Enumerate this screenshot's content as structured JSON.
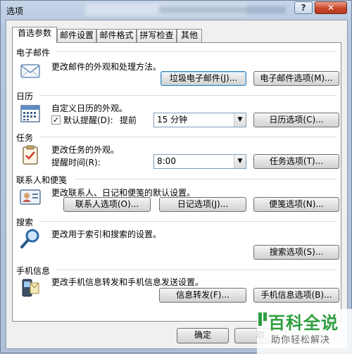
{
  "window": {
    "title": "选项"
  },
  "tabs": [
    "首选参数",
    "邮件设置",
    "邮件格式",
    "拼写检查",
    "其他"
  ],
  "sections": {
    "mail": {
      "title": "电子邮件",
      "desc": "更改邮件的外观和处理方法。",
      "btn_junk": "垃圾电子邮件(J)...",
      "btn_options": "电子邮件选项(M)..."
    },
    "calendar": {
      "title": "日历",
      "desc": "自定义日历的外观。",
      "reminder_label": "默认提醒(D):",
      "advance_label": "提前",
      "reminder_value": "15 分钟",
      "reminder_checked": true,
      "btn_options": "日历选项(C)..."
    },
    "tasks": {
      "title": "任务",
      "desc": "更改任务的外观。",
      "reminder_time_label": "提醒时间(R):",
      "reminder_time_value": "8:00",
      "btn_options": "任务选项(T)..."
    },
    "contacts": {
      "title": "联系人和便笺",
      "desc": "更改联系人、日记和便笺的默认设置。",
      "btn_contacts": "联系人选项(O)...",
      "btn_journal": "日记选项(J)...",
      "btn_notes": "便笺选项(N)..."
    },
    "search": {
      "title": "搜索",
      "desc": "更改用于索引和搜索的设置。",
      "btn_options": "搜索选项(S)..."
    },
    "mobile": {
      "title": "手机信息",
      "desc": "更改手机信息转发和手机信息发送设置。",
      "btn_forward": "信息转发(F)...",
      "btn_options": "手机信息选项(B)..."
    }
  },
  "footer": {
    "ok": "确定",
    "cancel": "取"
  },
  "watermark": {
    "title": "百科全说",
    "subtitle": "助你轻松解决"
  },
  "colors": {
    "accent": "#2f9e3f",
    "close": "#c8462b"
  }
}
